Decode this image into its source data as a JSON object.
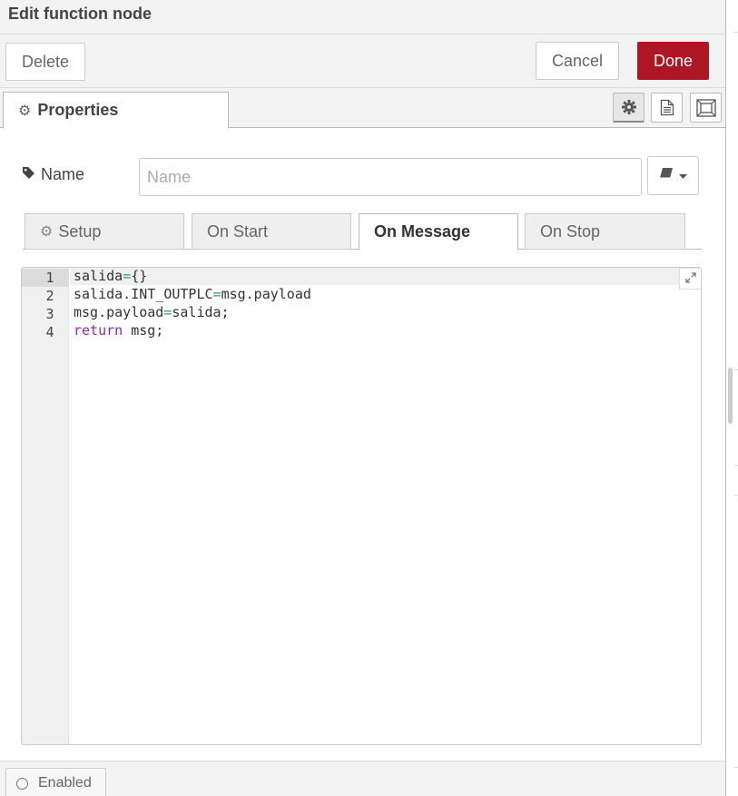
{
  "tray": {
    "title": "Edit function node"
  },
  "toolbar": {
    "delete_label": "Delete",
    "cancel_label": "Cancel",
    "done_label": "Done",
    "done_color": "#ad1625"
  },
  "tabs": {
    "properties_label": "Properties",
    "icon_buttons": [
      "gear-icon",
      "description-icon",
      "appearance-icon"
    ]
  },
  "name_field": {
    "label": "Name",
    "placeholder": "Name",
    "value": ""
  },
  "subtabs": [
    {
      "label": "Setup",
      "icon": "gear-icon",
      "active": false
    },
    {
      "label": "On Start",
      "active": false
    },
    {
      "label": "On Message",
      "active": true
    },
    {
      "label": "On Stop",
      "active": false
    }
  ],
  "editor": {
    "line_numbers": [
      "1",
      "2",
      "3",
      "4"
    ],
    "lines": [
      {
        "tokens": [
          [
            "",
            "salida"
          ],
          [
            "op",
            "="
          ],
          [
            "",
            "{}"
          ]
        ]
      },
      {
        "tokens": [
          [
            "",
            "salida.INT_OUTPLC"
          ],
          [
            "op",
            "="
          ],
          [
            "",
            "msg.payload"
          ]
        ]
      },
      {
        "tokens": [
          [
            "",
            "msg.payload"
          ],
          [
            "op",
            "="
          ],
          [
            "",
            "salida;"
          ]
        ]
      },
      {
        "tokens": [
          [
            "kw",
            "return"
          ],
          [
            "",
            " msg;"
          ]
        ]
      }
    ],
    "active_line": 1,
    "keyword_color": "#8a2ca3",
    "operator_color": "#2ca35a"
  },
  "footer": {
    "enabled_label": "Enabled"
  }
}
